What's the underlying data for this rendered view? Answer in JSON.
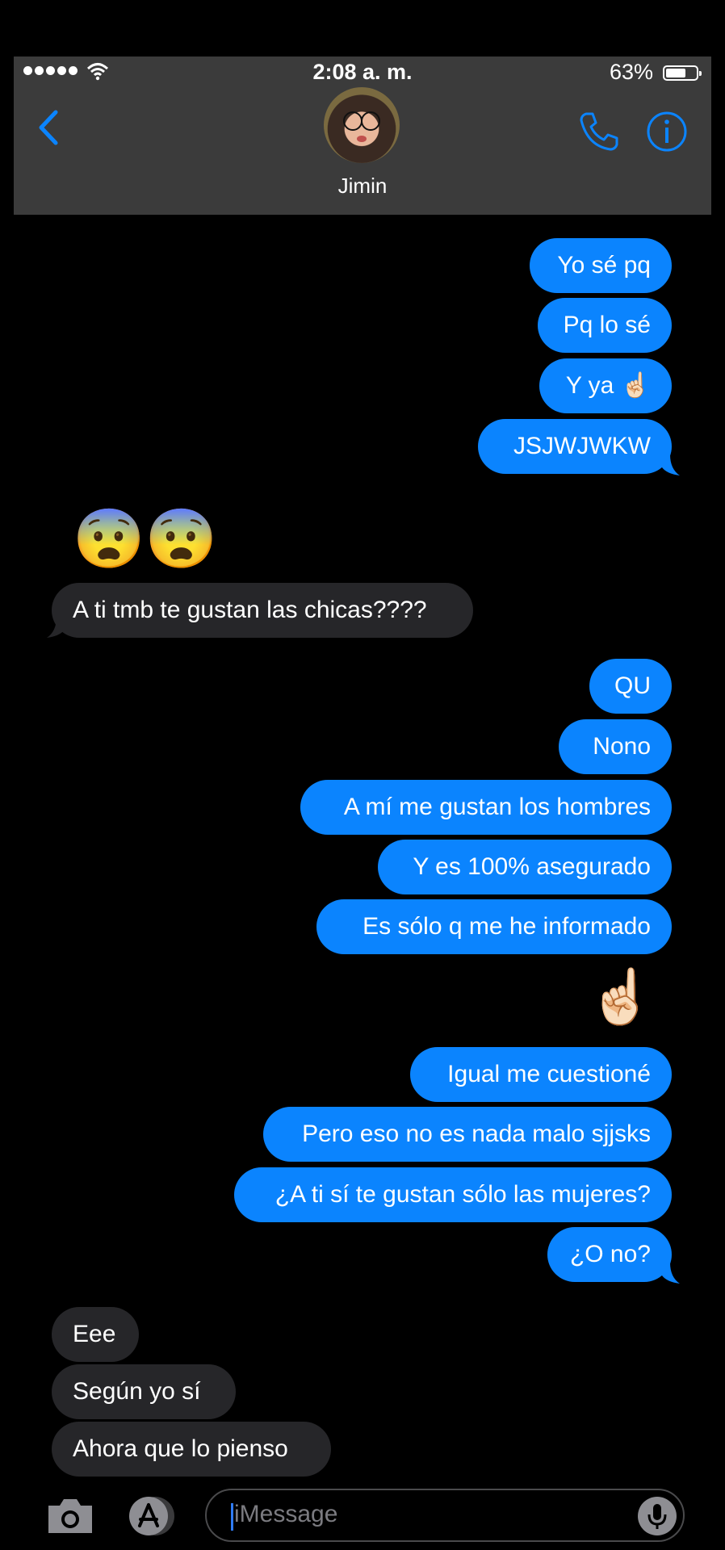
{
  "status_bar": {
    "time": "2:08 a. m.",
    "battery_percent": "63%",
    "battery_level": 0.63
  },
  "header": {
    "contact_name": "Jimin"
  },
  "colors": {
    "outgoing_bubble": "#0b84fe",
    "incoming_bubble": "#262629",
    "accent": "#0b84fe",
    "header_bg": "#3b3b3b"
  },
  "messages": {
    "m1": "Yo sé pq",
    "m2": "Pq lo sé",
    "m3": "Y ya ☝🏻",
    "m4": "JSJWJWKW",
    "m5": "😨😨",
    "m6": "A ti tmb te gustan las chicas????",
    "m7": "QU",
    "m8": "Nono",
    "m9": "A mí me gustan los hombres",
    "m10": "Y es 100% asegurado",
    "m11": "Es sólo q me he informado",
    "m12": "☝🏻",
    "m13": "Igual me cuestioné",
    "m14": "Pero eso no es nada malo sjjsks",
    "m15": "¿A ti sí te gustan sólo las mujeres?",
    "m16": "¿O no?",
    "m17": "Eee",
    "m18": "Según yo sí",
    "m19": "Ahora que lo pienso"
  },
  "input": {
    "placeholder": "iMessage"
  },
  "icons": [
    "back-chevron-icon",
    "wifi-icon",
    "phone-icon",
    "info-icon",
    "camera-icon",
    "app-store-icon",
    "microphone-icon"
  ]
}
